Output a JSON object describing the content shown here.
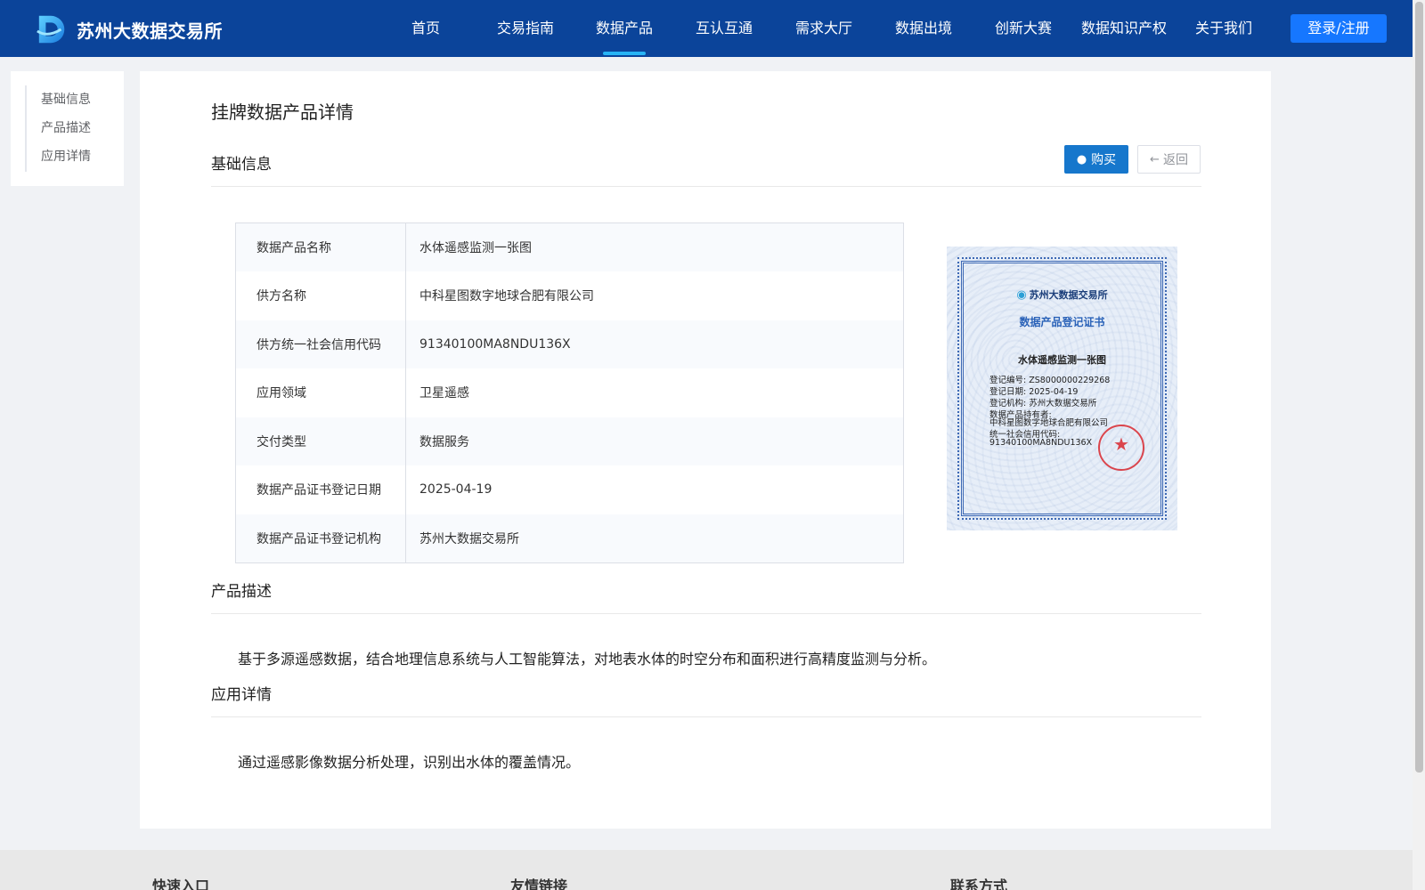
{
  "header": {
    "brand": "苏州大数据交易所",
    "nav": [
      {
        "label": "首页",
        "active": false
      },
      {
        "label": "交易指南",
        "active": false
      },
      {
        "label": "数据产品",
        "active": true
      },
      {
        "label": "互认互通",
        "active": false
      },
      {
        "label": "需求大厅",
        "active": false
      },
      {
        "label": "数据出境",
        "active": false
      },
      {
        "label": "创新大赛",
        "active": false
      },
      {
        "label": "数据知识产权",
        "active": false
      },
      {
        "label": "关于我们",
        "active": false
      }
    ],
    "login_label": "登录/注册"
  },
  "sidenav": {
    "items": [
      {
        "label": "基础信息"
      },
      {
        "label": "产品描述"
      },
      {
        "label": "应用详情"
      }
    ]
  },
  "main": {
    "page_title": "挂牌数据产品详情",
    "basic_info": {
      "title": "基础信息",
      "buy_label": "购买",
      "back_label": "返回",
      "rows": [
        {
          "key": "数据产品名称",
          "value": "水体遥感监测一张图"
        },
        {
          "key": "供方名称",
          "value": "中科星图数字地球合肥有限公司"
        },
        {
          "key": "供方统一社会信用代码",
          "value": "91340100MA8NDU136X"
        },
        {
          "key": "应用领域",
          "value": "卫星遥感"
        },
        {
          "key": "交付类型",
          "value": "数据服务"
        },
        {
          "key": "数据产品证书登记日期",
          "value": "2025-04-19"
        },
        {
          "key": "数据产品证书登记机构",
          "value": "苏州大数据交易所"
        }
      ]
    },
    "certificate": {
      "logo_text": "苏州大数据交易所",
      "title": "数据产品登记证书",
      "product_name": "水体遥感监测一张图",
      "lines": [
        "登记编号: ZS8000000229268",
        "登记日期: 2025-04-19",
        "登记机构: 苏州大数据交易所",
        "数据产品持有者:",
        "中科星图数字地球合肥有限公司",
        "统一社会信用代码:",
        "91340100MA8NDU136X"
      ]
    },
    "description": {
      "title": "产品描述",
      "text": "基于多源遥感数据，结合地理信息系统与人工智能算法，对地表水体的时空分布和面积进行高精度监测与分析。"
    },
    "application": {
      "title": "应用详情",
      "text": "通过遥感影像数据分析处理，识别出水体的覆盖情况。"
    }
  },
  "footer": {
    "columns": [
      {
        "title": "快速入口"
      },
      {
        "title": "友情链接"
      },
      {
        "title": "联系方式"
      }
    ]
  },
  "colors": {
    "header_bg": "#0b449a",
    "nav_active_indicator": "#27b4f5",
    "primary_button": "#1677cc",
    "login_button": "#1677ff"
  },
  "icons": {
    "buy": "money-bag-icon",
    "back": "arrow-left-icon"
  }
}
